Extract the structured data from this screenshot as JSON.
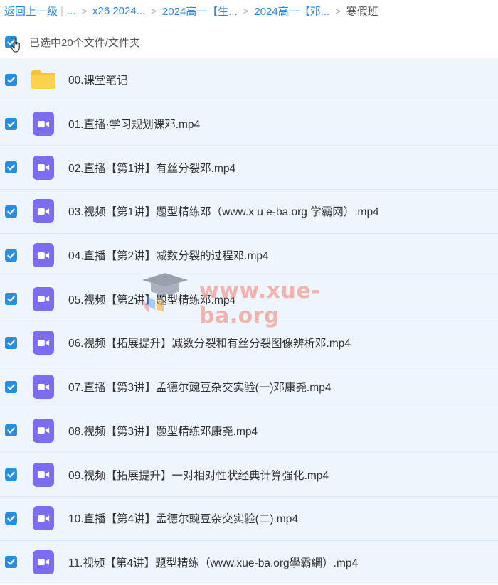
{
  "breadcrumb": {
    "back": "返回上一级",
    "ellipsis": "...",
    "crumbs": [
      "x26 2024...",
      "2024高一【生...",
      "2024高一【邓..."
    ],
    "current": "寒假班"
  },
  "selection": {
    "text": "已选中20个文件/文件夹",
    "checked": true
  },
  "files": [
    {
      "name": "00.课堂笔记",
      "type": "folder"
    },
    {
      "name": "01.直播·学习规划课邓.mp4",
      "type": "video"
    },
    {
      "name": "02.直播【第1讲】有丝分裂邓.mp4",
      "type": "video"
    },
    {
      "name": "03.视频【第1讲】题型精练邓（www.x u e-ba.org 学霸网）.mp4",
      "type": "video"
    },
    {
      "name": "04.直播【第2讲】减数分裂的过程邓.mp4",
      "type": "video"
    },
    {
      "name": "05.视频【第2讲】题型精练邓.mp4",
      "type": "video"
    },
    {
      "name": "06.视频【拓展提升】减数分裂和有丝分裂图像辨析邓.mp4",
      "type": "video"
    },
    {
      "name": "07.直播【第3讲】孟德尔豌豆杂交实验(一)邓康尧.mp4",
      "type": "video"
    },
    {
      "name": "08.视频【第3讲】题型精练邓康尧.mp4",
      "type": "video"
    },
    {
      "name": "09.视频【拓展提升】一对相对性状经典计算强化.mp4",
      "type": "video"
    },
    {
      "name": "10.直播【第4讲】孟德尔豌豆杂交实验(二).mp4",
      "type": "video"
    },
    {
      "name": "11.视频【第4讲】题型精练（www.xue-ba.org學霸網）.mp4",
      "type": "video"
    }
  ],
  "watermark": {
    "text": "www.xue-ba.org"
  },
  "colors": {
    "accent": "#2a8ee0",
    "row_bg": "#eef5fd",
    "video_icon": "#7b6cf0",
    "folder": "#fcd34d"
  }
}
